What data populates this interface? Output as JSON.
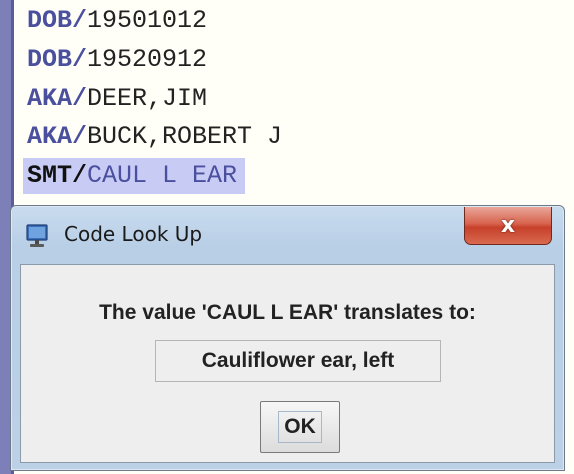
{
  "record": {
    "lines": [
      {
        "code": "DOB",
        "value": "19501012"
      },
      {
        "code": "DOB",
        "value": "19520912"
      },
      {
        "code": "AKA",
        "value": "DEER,JIM"
      },
      {
        "code": "AKA",
        "value": "BUCK,ROBERT J"
      },
      {
        "code": "SMT",
        "value": "CAUL L EAR"
      }
    ],
    "separator": "/"
  },
  "dialog": {
    "title": "Code Look Up",
    "close_label": "x",
    "message": "The value 'CAUL L EAR' translates to:",
    "translation": "Cauliflower ear, left",
    "ok_label": "OK"
  },
  "icons": {
    "title": "computer-monitor-icon",
    "close": "close-icon"
  },
  "colors": {
    "code_text": "#4a4f9e",
    "selection": "#c8cbf4",
    "close_button": "#c7402a",
    "dialog_frame": "#b9cfe6"
  }
}
